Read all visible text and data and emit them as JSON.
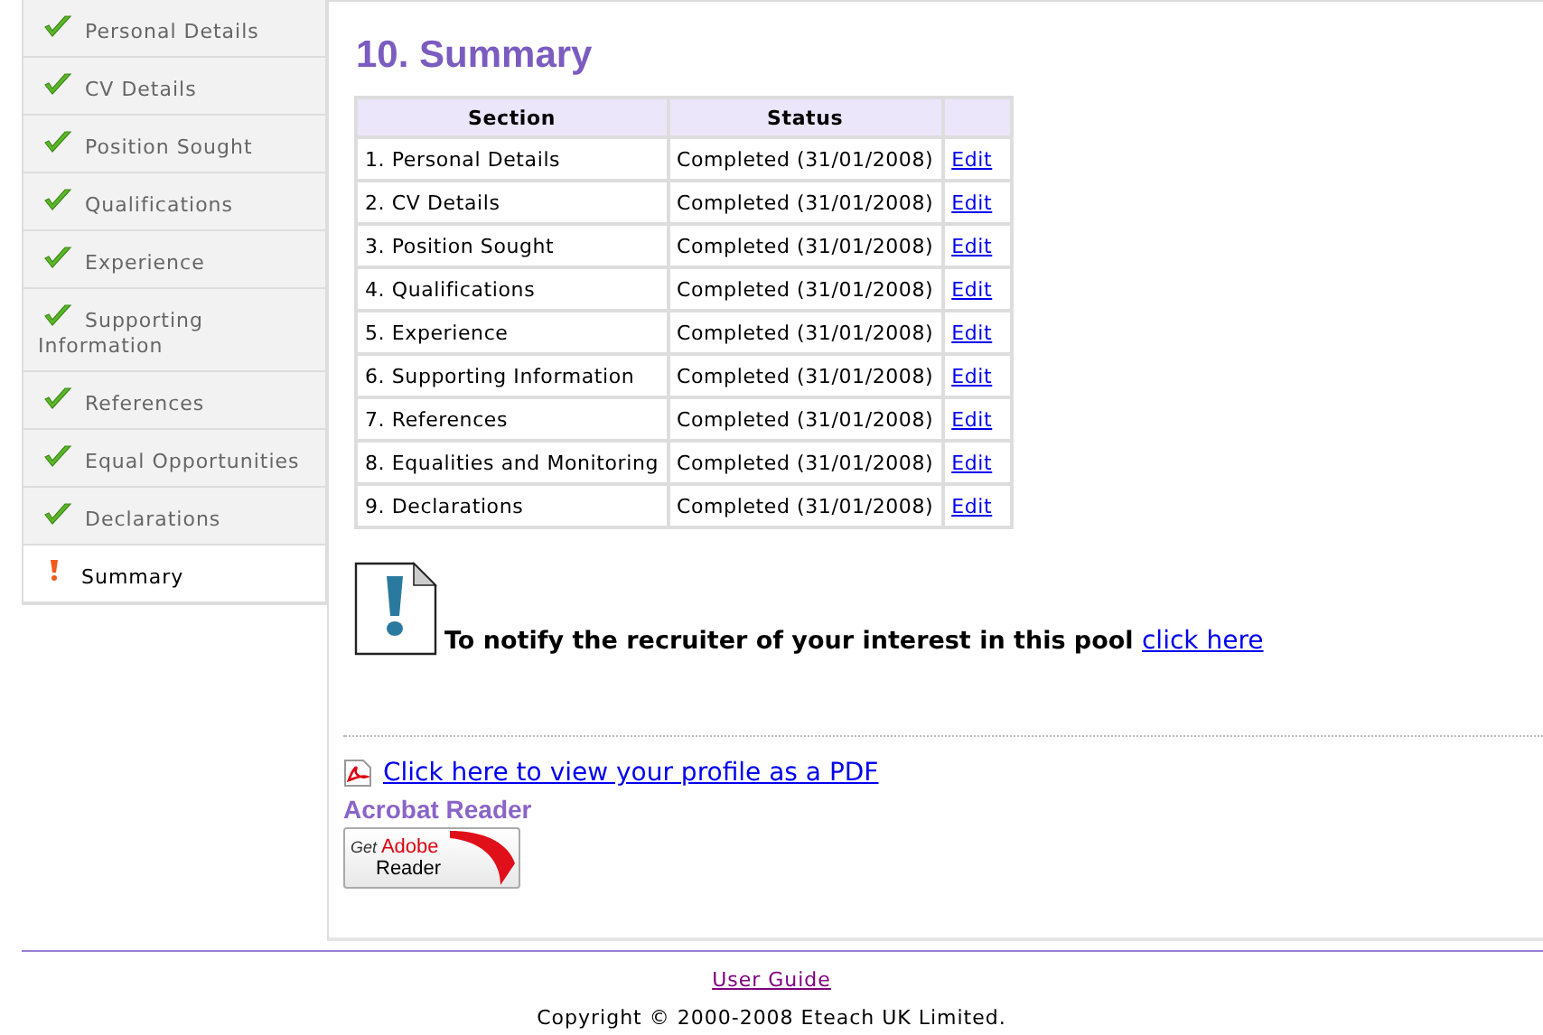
{
  "sidebar": {
    "items": [
      {
        "label": "Personal Details",
        "completed": true,
        "selected": false
      },
      {
        "label": "CV Details",
        "completed": true,
        "selected": false
      },
      {
        "label": "Position Sought",
        "completed": true,
        "selected": false
      },
      {
        "label": "Qualifications",
        "completed": true,
        "selected": false
      },
      {
        "label": "Experience",
        "completed": true,
        "selected": false
      },
      {
        "label": "Supporting Information",
        "completed": true,
        "selected": false
      },
      {
        "label": "References",
        "completed": true,
        "selected": false
      },
      {
        "label": "Equal Opportunities",
        "completed": true,
        "selected": false
      },
      {
        "label": "Declarations",
        "completed": true,
        "selected": false
      },
      {
        "label": "Summary",
        "completed": false,
        "selected": true
      }
    ]
  },
  "title": "10. Summary",
  "table": {
    "columns": [
      "Section",
      "Status"
    ],
    "rows": [
      {
        "section": "1. Personal Details",
        "status": "Completed (31/01/2008)",
        "action": "Edit"
      },
      {
        "section": "2. CV Details",
        "status": "Completed (31/01/2008)",
        "action": "Edit"
      },
      {
        "section": "3. Position Sought",
        "status": "Completed (31/01/2008)",
        "action": "Edit"
      },
      {
        "section": "4. Qualifications",
        "status": "Completed (31/01/2008)",
        "action": "Edit"
      },
      {
        "section": "5. Experience",
        "status": "Completed (31/01/2008)",
        "action": "Edit"
      },
      {
        "section": "6. Supporting Information",
        "status": "Completed (31/01/2008)",
        "action": "Edit"
      },
      {
        "section": "7. References",
        "status": "Completed (31/01/2008)",
        "action": "Edit"
      },
      {
        "section": "8. Equalities and Monitoring",
        "status": "Completed (31/01/2008)",
        "action": "Edit"
      },
      {
        "section": "9. Declarations",
        "status": "Completed (31/01/2008)",
        "action": "Edit"
      }
    ]
  },
  "notice": {
    "text": "To notify the recruiter of your interest in this pool",
    "link": "click here"
  },
  "pdf_link": "Click here to view your profile as a PDF",
  "acrobat": {
    "heading": "Acrobat Reader",
    "badge_small": "Get",
    "badge_brand": "Adobe",
    "badge_product": "Reader"
  },
  "footer": {
    "link": "User Guide",
    "copyright": "Copyright © 2000-2008 Eteach UK Limited."
  }
}
